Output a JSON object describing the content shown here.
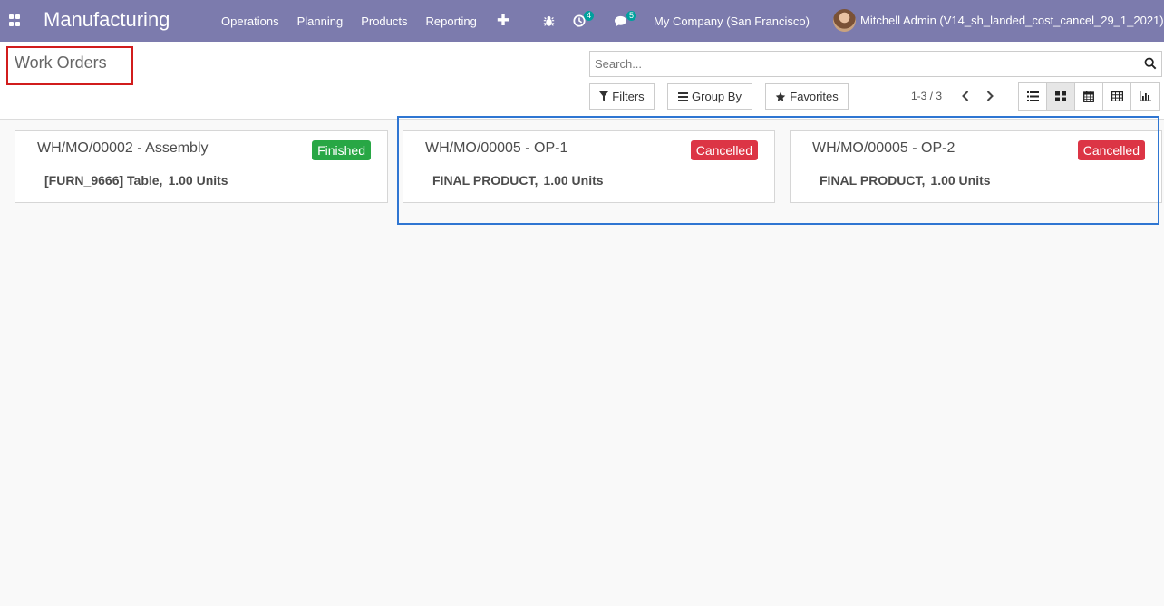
{
  "navbar": {
    "brand": "Manufacturing",
    "menu": [
      "Operations",
      "Planning",
      "Products",
      "Reporting"
    ],
    "activity_count": "4",
    "messages_count": "5",
    "company": "My Company (San Francisco)",
    "user": "Mitchell Admin (V14_sh_landed_cost_cancel_29_1_2021)"
  },
  "control_panel": {
    "title": "Work Orders",
    "search_placeholder": "Search...",
    "filters_label": "Filters",
    "groupby_label": "Group By",
    "favorites_label": "Favorites",
    "pager": "1-3 / 3",
    "views": [
      "list-icon",
      "kanban-icon",
      "calendar-icon",
      "pivot-icon",
      "graph-icon"
    ],
    "active_view": "kanban-icon"
  },
  "cards": [
    {
      "title": "WH/MO/00002 - Assembly",
      "state": "Finished",
      "product": "[FURN_9666] Table,",
      "qty": "1.00 Units"
    },
    {
      "title": "WH/MO/00005 - OP-1",
      "state": "Cancelled",
      "product": "FINAL PRODUCT,",
      "qty": "1.00 Units"
    },
    {
      "title": "WH/MO/00005 - OP-2",
      "state": "Cancelled",
      "product": "FINAL PRODUCT,",
      "qty": "1.00 Units"
    }
  ],
  "colors": {
    "navbar": "#7c7bad",
    "finished": "#28a745",
    "cancelled": "#dc3545",
    "title_highlight": "#d11c1c",
    "cards_highlight": "#2f76d2"
  }
}
